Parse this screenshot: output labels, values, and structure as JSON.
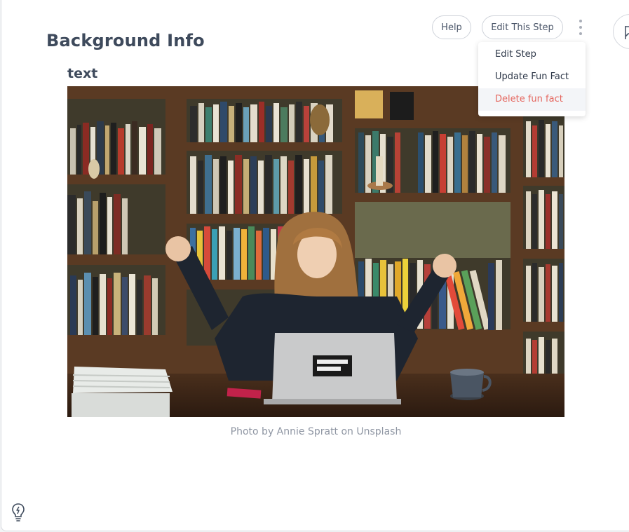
{
  "header": {
    "title": "Background Info",
    "help_label": "Help",
    "edit_label": "Edit This Step"
  },
  "menu": {
    "items": [
      {
        "label": "Edit Step"
      },
      {
        "label": "Update Fun Fact"
      },
      {
        "label": "Delete fun fact"
      }
    ]
  },
  "content": {
    "subtitle": "text",
    "caption": "Photo by Annie Spratt on Unsplash"
  },
  "icons": {
    "kebab": "more-vertical-icon",
    "flag": "flag-icon",
    "bulb": "lightbulb-icon"
  },
  "colors": {
    "danger": "#e5675f",
    "title": "#3e4a5c",
    "caption": "#8f96a3"
  }
}
